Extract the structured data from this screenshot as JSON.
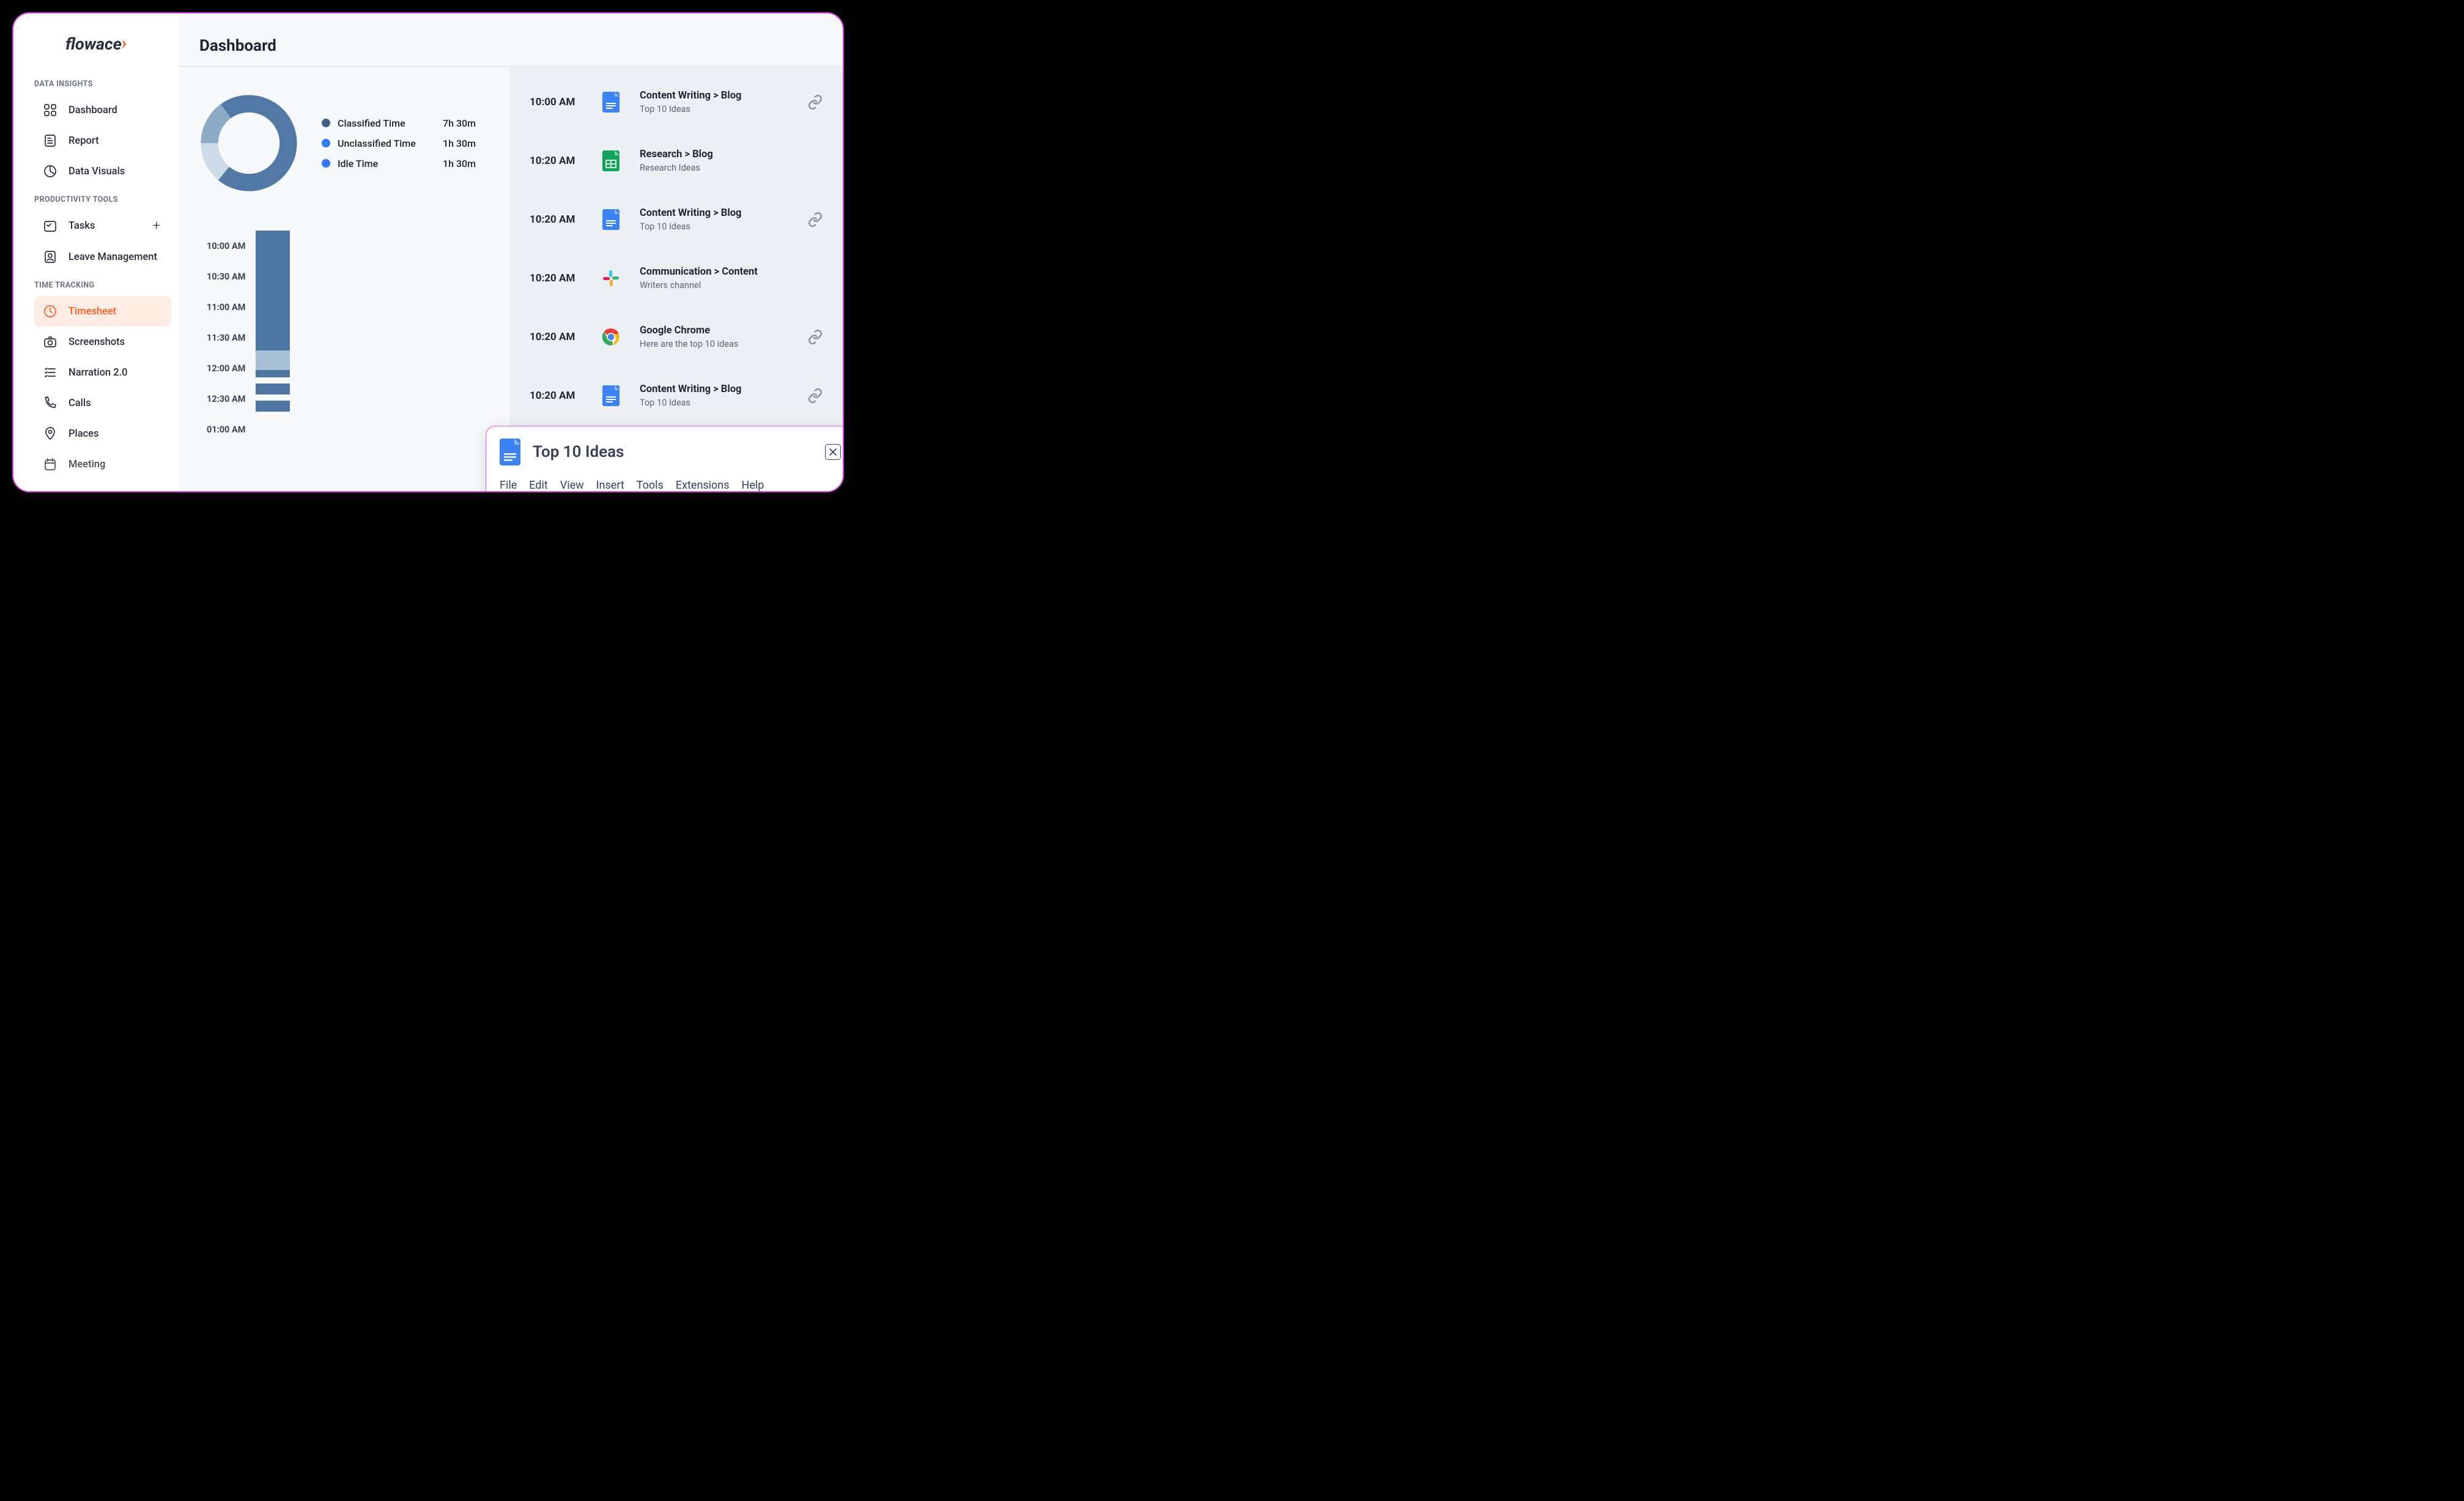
{
  "brand": {
    "name": "flowace"
  },
  "sidebar": {
    "sections": [
      {
        "label": "DATA INSIGHTS",
        "items": [
          {
            "label": "Dashboard"
          },
          {
            "label": "Report"
          },
          {
            "label": "Data Visuals"
          }
        ]
      },
      {
        "label": "PRODUCTIVITY TOOLS",
        "items": [
          {
            "label": "Tasks"
          },
          {
            "label": "Leave Management"
          }
        ]
      },
      {
        "label": "TIME TRACKING",
        "items": [
          {
            "label": "Timesheet"
          },
          {
            "label": "Screenshots"
          },
          {
            "label": "Narration 2.0"
          },
          {
            "label": "Calls"
          },
          {
            "label": "Places"
          },
          {
            "label": "Meeting"
          }
        ]
      }
    ]
  },
  "page": {
    "title": "Dashboard"
  },
  "chart_data": {
    "type": "pie",
    "title": "",
    "series": [
      {
        "name": "Classified Time",
        "label": "7h 30m",
        "value": 450,
        "color": "#5279a6"
      },
      {
        "name": "Unclassified Time",
        "label": "1h 30m",
        "value": 90,
        "color": "#8aaac6"
      },
      {
        "name": "Idle Time",
        "label": "1h 30m",
        "value": 90,
        "color": "#cddbe8"
      }
    ],
    "legend_dots": [
      "#3e5f88",
      "#2d7af6",
      "#2d7af6"
    ]
  },
  "timeline": {
    "ticks": [
      "10:00 AM",
      "10:30 AM",
      "11:00 AM",
      "11:30 AM",
      "12:00 AM",
      "12:30 AM",
      "01:00 AM"
    ],
    "segments": [
      {
        "start_pct": 0,
        "height_pct": 56,
        "color": "#4d76a3"
      },
      {
        "start_pct": 56,
        "height_pct": 9,
        "color": "#a7bfd6"
      },
      {
        "start_pct": 65,
        "height_pct": 3.5,
        "color": "#4d76a3"
      },
      {
        "start_pct": 68.5,
        "height_pct": 3,
        "color": "#f7f8fa"
      },
      {
        "start_pct": 71.5,
        "height_pct": 5,
        "color": "#4d76a3"
      },
      {
        "start_pct": 76.5,
        "height_pct": 3,
        "color": "#f7f8fa"
      },
      {
        "start_pct": 79.5,
        "height_pct": 5,
        "color": "#4d76a3"
      }
    ]
  },
  "activities": [
    {
      "time": "10:00 AM",
      "icon": "gdoc",
      "title": "Content Writing > Blog",
      "sub": "Top 10 Ideas",
      "link": true
    },
    {
      "time": "10:20 AM",
      "icon": "gsheet",
      "title": "Research > Blog",
      "sub": "Research Ideas",
      "link": false
    },
    {
      "time": "10:20 AM",
      "icon": "gdoc",
      "title": "Content Writing > Blog",
      "sub": "Top 10 Ideas",
      "link": true
    },
    {
      "time": "10:20 AM",
      "icon": "slack",
      "title": "Communication > Content",
      "sub": "Writers channel",
      "link": false
    },
    {
      "time": "10:20 AM",
      "icon": "chrome",
      "title": "Google Chrome",
      "sub": "Here are the top 10 ideas",
      "link": true
    },
    {
      "time": "10:20 AM",
      "icon": "gdoc",
      "title": "Content Writing > Blog",
      "sub": "Top 10 Ideas",
      "link": true
    }
  ],
  "popup": {
    "title": "Top 10 Ideas",
    "menu": [
      "File",
      "Edit",
      "View",
      "Insert",
      "Tools",
      "Extensions",
      "Help"
    ]
  }
}
